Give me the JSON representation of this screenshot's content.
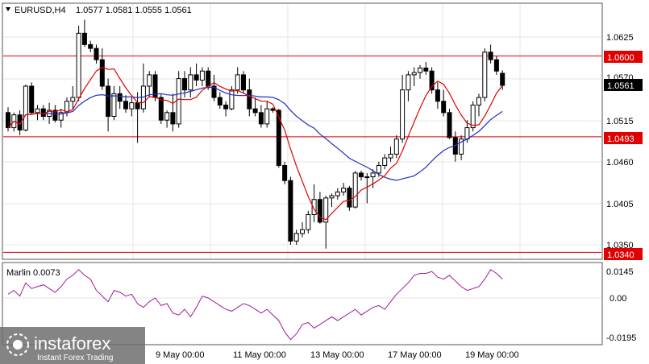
{
  "header": {
    "symbol_label": "EURUSD,H4",
    "ohlc": "1.0577 1.0581 1.0555 1.0561"
  },
  "price_axis": {
    "ticks": [
      "1.0625",
      "1.0570",
      "1.0515",
      "1.0460",
      "1.0405",
      "1.0350"
    ],
    "tagged_levels": [
      {
        "label": "1.0600",
        "value": 1.06,
        "color": "#e00000"
      },
      {
        "label": "1.0561",
        "value": 1.0561,
        "color": "#000000"
      },
      {
        "label": "1.0493",
        "value": 1.0493,
        "color": "#e00000"
      },
      {
        "label": "1.0340",
        "value": 1.034,
        "color": "#e00000"
      }
    ]
  },
  "indicator": {
    "name_label": "Marlin 0.0073",
    "ticks": [
      "0.0145",
      "0.00",
      "-0.0195"
    ]
  },
  "time_axis": {
    "labels": [
      "9 May 00:00",
      "11 May 00:00",
      "13 May 00:00",
      "17 May 00:00",
      "19 May 00:00"
    ]
  },
  "watermark": {
    "brand": "instaforex",
    "tagline": "Instant Forex Trading"
  },
  "colors": {
    "bull": "#ffffff",
    "bear": "#000000",
    "ma_fast": "#e00000",
    "ma_slow": "#1f2fbf",
    "indicator_line": "#a01a9a",
    "level_line": "#e00000",
    "grid": "#e6e6e6"
  },
  "chart_data": {
    "type": "candlestick",
    "symbol": "EURUSD",
    "timeframe": "H4",
    "candles": [
      [
        1.0525,
        1.0532,
        1.05,
        1.0505
      ],
      [
        1.0505,
        1.0525,
        1.05,
        1.0522
      ],
      [
        1.0522,
        1.0528,
        1.0495,
        1.0502
      ],
      [
        1.0502,
        1.0562,
        1.05,
        1.056
      ],
      [
        1.056,
        1.0565,
        1.0522,
        1.0525
      ],
      [
        1.0525,
        1.0535,
        1.0515,
        1.053
      ],
      [
        1.053,
        1.0535,
        1.0515,
        1.052
      ],
      [
        1.052,
        1.0538,
        1.051,
        1.0528
      ],
      [
        1.0528,
        1.0535,
        1.0512,
        1.0515
      ],
      [
        1.0515,
        1.053,
        1.0505,
        1.0525
      ],
      [
        1.0525,
        1.0545,
        1.052,
        1.054
      ],
      [
        1.054,
        1.056,
        1.053,
        1.0545
      ],
      [
        1.0545,
        1.064,
        1.054,
        1.063
      ],
      [
        1.063,
        1.0648,
        1.0612,
        1.0615
      ],
      [
        1.0615,
        1.062,
        1.0605,
        1.061
      ],
      [
        1.061,
        1.0615,
        1.059,
        1.0595
      ],
      [
        1.0595,
        1.061,
        1.0555,
        1.056
      ],
      [
        1.056,
        1.057,
        1.05,
        1.052
      ],
      [
        1.052,
        1.056,
        1.0515,
        1.055
      ],
      [
        1.055,
        1.056,
        1.053,
        1.054
      ],
      [
        1.054,
        1.0548,
        1.0525,
        1.053
      ],
      [
        1.053,
        1.0545,
        1.052,
        1.0538
      ],
      [
        1.0538,
        1.0552,
        1.0485,
        1.053
      ],
      [
        1.053,
        1.059,
        1.0525,
        1.056
      ],
      [
        1.056,
        1.058,
        1.0545,
        1.0575
      ],
      [
        1.0575,
        1.058,
        1.054,
        1.0545
      ],
      [
        1.0545,
        1.055,
        1.051,
        1.0515
      ],
      [
        1.0515,
        1.0528,
        1.0505,
        1.0525
      ],
      [
        1.0525,
        1.055,
        1.05,
        1.051
      ],
      [
        1.051,
        1.058,
        1.0505,
        1.057
      ],
      [
        1.057,
        1.058,
        1.0545,
        1.0555
      ],
      [
        1.0555,
        1.0585,
        1.0545,
        1.0575
      ],
      [
        1.0575,
        1.059,
        1.056,
        1.0568
      ],
      [
        1.0568,
        1.0585,
        1.056,
        1.058
      ],
      [
        1.058,
        1.0585,
        1.0555,
        1.056
      ],
      [
        1.056,
        1.0575,
        1.054,
        1.0545
      ],
      [
        1.0545,
        1.0552,
        1.053,
        1.0535
      ],
      [
        1.0535,
        1.054,
        1.052,
        1.053
      ],
      [
        1.053,
        1.056,
        1.0528,
        1.0555
      ],
      [
        1.0555,
        1.0585,
        1.055,
        1.0575
      ],
      [
        1.0575,
        1.058,
        1.055,
        1.0555
      ],
      [
        1.0555,
        1.057,
        1.052,
        1.053
      ],
      [
        1.053,
        1.0545,
        1.052,
        1.0525
      ],
      [
        1.0525,
        1.0535,
        1.0505,
        1.051
      ],
      [
        1.051,
        1.054,
        1.0505,
        1.053
      ],
      [
        1.053,
        1.0532,
        1.0525,
        1.0528
      ],
      [
        1.0528,
        1.053,
        1.0452,
        1.0455
      ],
      [
        1.0455,
        1.046,
        1.043,
        1.0435
      ],
      [
        1.0435,
        1.044,
        1.035,
        1.0355
      ],
      [
        1.0355,
        1.037,
        1.035,
        1.0365
      ],
      [
        1.0365,
        1.038,
        1.036,
        1.037
      ],
      [
        1.037,
        1.0395,
        1.0365,
        1.039
      ],
      [
        1.039,
        1.043,
        1.038,
        1.041
      ],
      [
        1.041,
        1.042,
        1.0378,
        1.038
      ],
      [
        1.038,
        1.0415,
        1.0345,
        1.0412
      ],
      [
        1.0412,
        1.0418,
        1.04,
        1.0415
      ],
      [
        1.0415,
        1.0425,
        1.041,
        1.042
      ],
      [
        1.042,
        1.0432,
        1.0415,
        1.0425
      ],
      [
        1.0425,
        1.0428,
        1.0395,
        1.04
      ],
      [
        1.04,
        1.0448,
        1.0398,
        1.0445
      ],
      [
        1.0445,
        1.0448,
        1.0435,
        1.044
      ],
      [
        1.044,
        1.0445,
        1.0405,
        1.044
      ],
      [
        1.044,
        1.045,
        1.0425,
        1.0445
      ],
      [
        1.0445,
        1.046,
        1.044,
        1.0455
      ],
      [
        1.0455,
        1.047,
        1.045,
        1.0465
      ],
      [
        1.0465,
        1.048,
        1.046,
        1.047
      ],
      [
        1.047,
        1.0495,
        1.0465,
        1.049
      ],
      [
        1.049,
        1.0575,
        1.0485,
        1.0555
      ],
      [
        1.0555,
        1.058,
        1.054,
        1.0575
      ],
      [
        1.0575,
        1.0585,
        1.056,
        1.0578
      ],
      [
        1.0578,
        1.0588,
        1.057,
        1.0584
      ],
      [
        1.0584,
        1.0592,
        1.0575,
        1.058
      ],
      [
        1.058,
        1.0585,
        1.055,
        1.0555
      ],
      [
        1.0555,
        1.0565,
        1.053,
        1.054
      ],
      [
        1.054,
        1.0555,
        1.052,
        1.0525
      ],
      [
        1.0525,
        1.053,
        1.049,
        1.0492
      ],
      [
        1.0492,
        1.05,
        1.046,
        1.047
      ],
      [
        1.047,
        1.0495,
        1.0462,
        1.049
      ],
      [
        1.049,
        1.0515,
        1.0485,
        1.0505
      ],
      [
        1.0505,
        1.054,
        1.05,
        1.0535
      ],
      [
        1.0535,
        1.055,
        1.052,
        1.0545
      ],
      [
        1.0545,
        1.061,
        1.054,
        1.0605
      ],
      [
        1.0605,
        1.0615,
        1.059,
        1.0595
      ],
      [
        1.0595,
        1.06,
        1.0575,
        1.058
      ],
      [
        1.0577,
        1.0581,
        1.0555,
        1.0561
      ]
    ],
    "indicator_values": [
      0.002,
      0.004,
      0.001,
      0.008,
      0.005,
      0.006,
      0.007,
      0.005,
      0.003,
      0.006,
      0.01,
      0.012,
      0.015,
      0.012,
      0.01,
      0.004,
      0.001,
      -0.002,
      0.004,
      0.003,
      0.001,
      0.002,
      -0.003,
      -0.005,
      -0.002,
      0.0,
      -0.004,
      -0.003,
      -0.008,
      -0.009,
      -0.006,
      -0.01,
      -0.005,
      0.001,
      0.0,
      -0.002,
      -0.004,
      -0.006,
      -0.007,
      -0.005,
      -0.003,
      -0.004,
      -0.006,
      -0.008,
      -0.006,
      -0.009,
      -0.012,
      -0.018,
      -0.022,
      -0.019,
      -0.014,
      -0.013,
      -0.016,
      -0.014,
      -0.012,
      -0.01,
      -0.012,
      -0.01,
      -0.008,
      -0.006,
      -0.009,
      -0.007,
      -0.005,
      -0.004,
      -0.006,
      -0.002,
      0.002,
      0.005,
      0.008,
      0.012,
      0.013,
      0.013,
      0.014,
      0.011,
      0.01,
      0.012,
      0.009,
      0.006,
      0.004,
      0.005,
      0.006,
      0.01,
      0.015,
      0.013,
      0.01
    ]
  }
}
